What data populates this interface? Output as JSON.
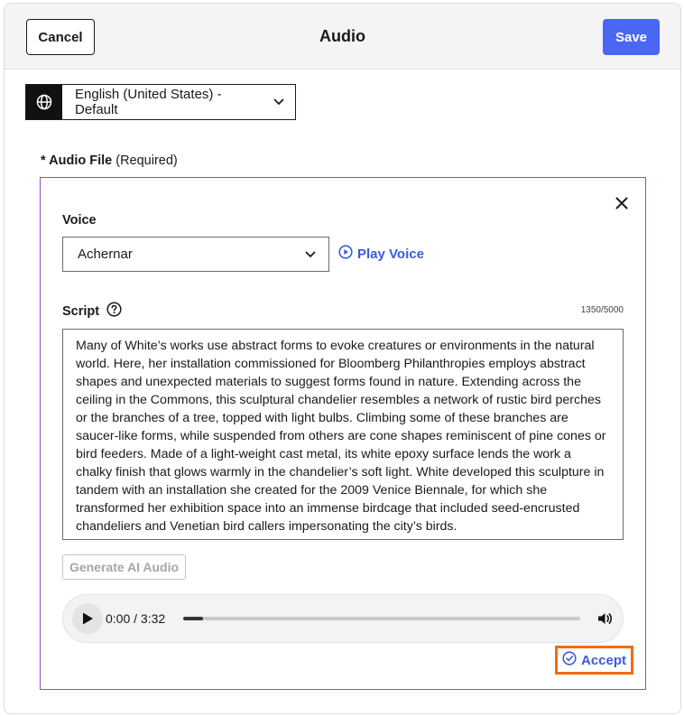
{
  "header": {
    "cancel_label": "Cancel",
    "title": "Audio",
    "save_label": "Save"
  },
  "language": {
    "selected": "English (United States) - Default",
    "icon": "globe-icon"
  },
  "audio_file": {
    "label_required_mark": "* Audio File",
    "label_hint": "(Required)"
  },
  "voice": {
    "label": "Voice",
    "selected": "Achernar",
    "play_label": "Play Voice"
  },
  "script": {
    "label": "Script",
    "char_count": "1350/5000",
    "text": "Many of White’s works use abstract forms to evoke creatures or environments in the natural world. Here, her installation commissioned for Bloomberg Philanthropies employs abstract shapes and unexpected materials to suggest forms found in nature. Extending across the ceiling in the Commons, this sculptural chandelier resembles a network of rustic bird perches or the branches of a tree, topped with light bulbs. Climbing some of these branches are saucer-like forms, while suspended from others are cone shapes reminiscent of pine cones or bird feeders. Made of a light-weight cast metal, its white epoxy surface lends the work a chalky finish that glows warmly in the chandelier’s soft light. White developed this sculpture in tandem with an installation she created for the 2009 Venice Biennale, for which she transformed her exhibition space into an immense birdcage that included seed-encrusted chandeliers and Venetian bird callers impersonating the city’s birds."
  },
  "generate_label": "Generate AI Audio",
  "player": {
    "time": "0:00 / 3:32",
    "progress_fraction": 0.05
  },
  "accept_label": "Accept",
  "colors": {
    "primary": "#4a66f5",
    "link": "#3b5bdb",
    "box_border": "#8e4ec6",
    "highlight": "#f26b0f"
  }
}
